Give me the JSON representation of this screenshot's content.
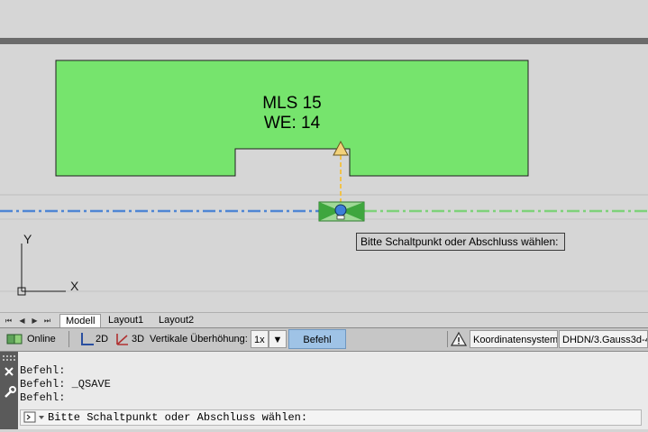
{
  "drawing": {
    "building_label_line1": "MLS 15",
    "building_label_line2": "WE: 14",
    "building_fill": "#76e46d",
    "axis_label_y": "Y",
    "axis_label_x": "X",
    "tooltip": "Bitte Schaltpunkt oder Abschluss wählen:"
  },
  "layout_tabs": {
    "nav_first": "⏮",
    "nav_prev": "◀",
    "nav_next": "▶",
    "nav_last": "⏭",
    "tabs": [
      "Modell",
      "Layout1",
      "Layout2"
    ],
    "active": "Modell"
  },
  "status_bar": {
    "online_label": "Online",
    "view_2d": "2D",
    "view_3d": "3D",
    "vertical_exaggeration_label": "Vertikale Überhöhung:",
    "vertical_exaggeration_value": "1x",
    "command_button": "Befehl",
    "coordinate_system_label": "Koordinatensystem:",
    "coordinate_system_value": "DHDN/3.Gauss3d-4"
  },
  "command_line": {
    "history": [
      "Befehl:",
      "Befehl: _QSAVE",
      "Befehl:"
    ],
    "prompt": "Bitte Schaltpunkt oder Abschluss wählen:"
  },
  "colors": {
    "blue_line": "#4f86d4",
    "green_line": "#7ed27a",
    "dark_band": "#6b6b6b"
  }
}
